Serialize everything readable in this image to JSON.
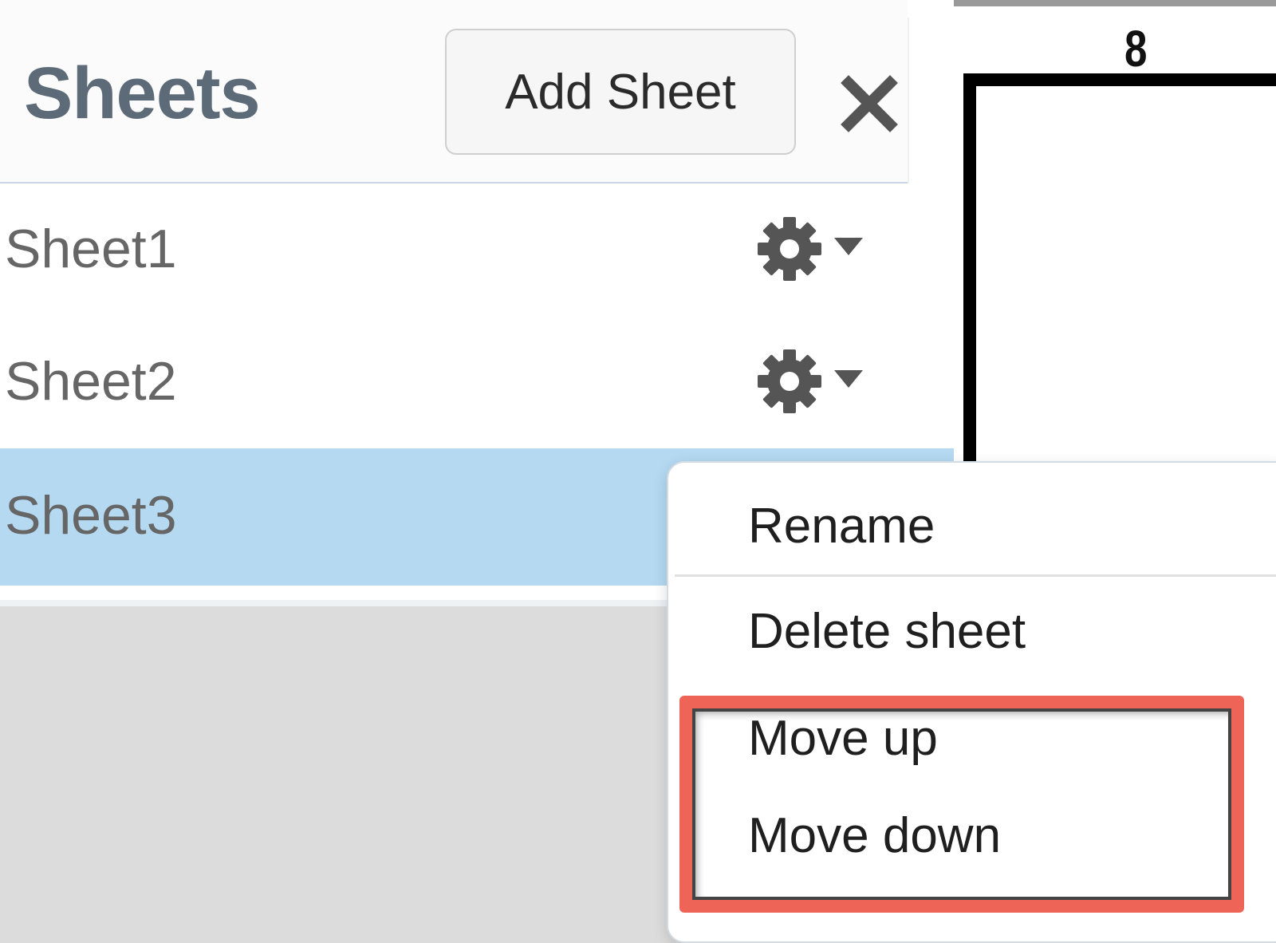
{
  "sheets_panel": {
    "title": "Sheets",
    "add_sheet_label": "Add Sheet",
    "sheets": [
      {
        "name": "Sheet1",
        "selected": false
      },
      {
        "name": "Sheet2",
        "selected": false
      },
      {
        "name": "Sheet3",
        "selected": true
      }
    ]
  },
  "canvas": {
    "label": "8"
  },
  "context_menu": {
    "items": [
      {
        "label": "Rename"
      },
      {
        "label": "Delete sheet"
      },
      {
        "label": "Move up"
      },
      {
        "label": "Move down"
      }
    ]
  },
  "colors": {
    "selected_row": "#b4d9f1",
    "highlight_box": "#ee6456",
    "title_text": "#5d6b78"
  },
  "icons": {
    "close": "close-icon",
    "sheet_settings": "gear-icon",
    "dropdown": "caret-down-icon"
  }
}
